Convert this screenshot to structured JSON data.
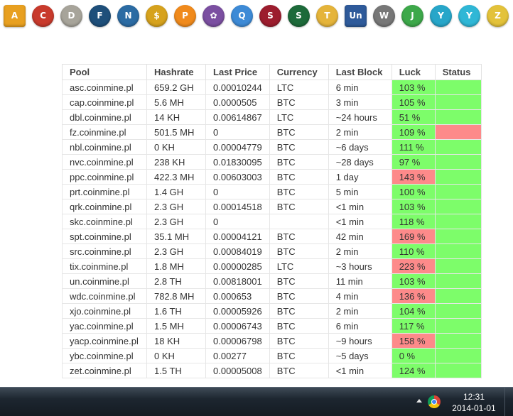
{
  "icons": [
    {
      "name": "asc-coin-icon",
      "color": "#e8a020",
      "glyph": "A",
      "shape": "square"
    },
    {
      "name": "cap-coin-icon",
      "color": "#c83a2c",
      "glyph": "C",
      "shape": "round"
    },
    {
      "name": "dbl-coin-icon",
      "color": "#a7a49a",
      "glyph": "D",
      "shape": "round"
    },
    {
      "name": "fz-coin-icon",
      "color": "#1e4f7a",
      "glyph": "F",
      "shape": "round"
    },
    {
      "name": "nbl-coin-icon",
      "color": "#2b6ba3",
      "glyph": "N",
      "shape": "round"
    },
    {
      "name": "nvc-coin-icon",
      "color": "#d6a21d",
      "glyph": "$",
      "shape": "round"
    },
    {
      "name": "ppc-coin-icon",
      "color": "#f08a1c",
      "glyph": "P",
      "shape": "round"
    },
    {
      "name": "prt-coin-icon",
      "color": "#7b4fa1",
      "glyph": "✿",
      "shape": "round"
    },
    {
      "name": "qrk-coin-icon",
      "color": "#3d8ad6",
      "glyph": "Q",
      "shape": "round"
    },
    {
      "name": "skc-coin-icon",
      "color": "#9c1d2e",
      "glyph": "S",
      "shape": "round"
    },
    {
      "name": "spt-coin-icon",
      "color": "#1d6a3a",
      "glyph": "S",
      "shape": "round"
    },
    {
      "name": "src-coin-icon",
      "color": "#e5b43a",
      "glyph": "T",
      "shape": "round"
    },
    {
      "name": "un-coin-icon",
      "color": "#2e5a9a",
      "glyph": "Un",
      "shape": "square"
    },
    {
      "name": "wdc-coin-icon",
      "color": "#777777",
      "glyph": "W",
      "shape": "round"
    },
    {
      "name": "xjo-coin-icon",
      "color": "#3da84a",
      "glyph": "J",
      "shape": "round"
    },
    {
      "name": "yac-coin-icon",
      "color": "#27a6c9",
      "glyph": "Y",
      "shape": "round"
    },
    {
      "name": "yacp-coin-icon",
      "color": "#2fb7d6",
      "glyph": "Y",
      "shape": "round"
    },
    {
      "name": "zet-coin-icon",
      "color": "#e3c23a",
      "glyph": "Z",
      "shape": "round"
    }
  ],
  "table": {
    "headers": {
      "pool": "Pool",
      "hashrate": "Hashrate",
      "last_price": "Last Price",
      "currency": "Currency",
      "last_block": "Last Block",
      "luck": "Luck",
      "status": "Status"
    },
    "rows": [
      {
        "pool": "asc.coinmine.pl",
        "hashrate": "659.2 GH",
        "last_price": "0.00010244",
        "currency": "LTC",
        "last_block": "6 min",
        "luck": "103 %",
        "luck_state": "good",
        "status_state": "good"
      },
      {
        "pool": "cap.coinmine.pl",
        "hashrate": "5.6 MH",
        "last_price": "0.0000505",
        "currency": "BTC",
        "last_block": "3 min",
        "luck": "105 %",
        "luck_state": "good",
        "status_state": "good"
      },
      {
        "pool": "dbl.coinmine.pl",
        "hashrate": "14 KH",
        "last_price": "0.00614867",
        "currency": "LTC",
        "last_block": "~24 hours",
        "luck": "51 %",
        "luck_state": "good",
        "status_state": "good"
      },
      {
        "pool": "fz.coinmine.pl",
        "hashrate": "501.5 MH",
        "last_price": "0",
        "currency": "BTC",
        "last_block": "2 min",
        "luck": "109 %",
        "luck_state": "good",
        "status_state": "bad"
      },
      {
        "pool": "nbl.coinmine.pl",
        "hashrate": "0 KH",
        "last_price": "0.00004779",
        "currency": "BTC",
        "last_block": "~6 days",
        "luck": "111 %",
        "luck_state": "good",
        "status_state": "good"
      },
      {
        "pool": "nvc.coinmine.pl",
        "hashrate": "238 KH",
        "last_price": "0.01830095",
        "currency": "BTC",
        "last_block": "~28 days",
        "luck": "97 %",
        "luck_state": "good",
        "status_state": "good"
      },
      {
        "pool": "ppc.coinmine.pl",
        "hashrate": "422.3 MH",
        "last_price": "0.00603003",
        "currency": "BTC",
        "last_block": "1 day",
        "luck": "143 %",
        "luck_state": "bad",
        "status_state": "good"
      },
      {
        "pool": "prt.coinmine.pl",
        "hashrate": "1.4 GH",
        "last_price": "0",
        "currency": "BTC",
        "last_block": "5 min",
        "luck": "100 %",
        "luck_state": "good",
        "status_state": "good"
      },
      {
        "pool": "qrk.coinmine.pl",
        "hashrate": "2.3 GH",
        "last_price": "0.00014518",
        "currency": "BTC",
        "last_block": "<1 min",
        "luck": "103 %",
        "luck_state": "good",
        "status_state": "good"
      },
      {
        "pool": "skc.coinmine.pl",
        "hashrate": "2.3 GH",
        "last_price": "0",
        "currency": "",
        "last_block": "<1 min",
        "luck": "118 %",
        "luck_state": "good",
        "status_state": "good"
      },
      {
        "pool": "spt.coinmine.pl",
        "hashrate": "35.1 MH",
        "last_price": "0.00004121",
        "currency": "BTC",
        "last_block": "42 min",
        "luck": "169 %",
        "luck_state": "bad",
        "status_state": "good"
      },
      {
        "pool": "src.coinmine.pl",
        "hashrate": "2.3 GH",
        "last_price": "0.00084019",
        "currency": "BTC",
        "last_block": "2 min",
        "luck": "110 %",
        "luck_state": "good",
        "status_state": "good"
      },
      {
        "pool": "tix.coinmine.pl",
        "hashrate": "1.8 MH",
        "last_price": "0.00000285",
        "currency": "LTC",
        "last_block": "~3 hours",
        "luck": "223 %",
        "luck_state": "bad",
        "status_state": "good"
      },
      {
        "pool": "un.coinmine.pl",
        "hashrate": "2.8 TH",
        "last_price": "0.00818001",
        "currency": "BTC",
        "last_block": "11 min",
        "luck": "103 %",
        "luck_state": "good",
        "status_state": "good"
      },
      {
        "pool": "wdc.coinmine.pl",
        "hashrate": "782.8 MH",
        "last_price": "0.000653",
        "currency": "BTC",
        "last_block": "4 min",
        "luck": "136 %",
        "luck_state": "bad",
        "status_state": "good"
      },
      {
        "pool": "xjo.coinmine.pl",
        "hashrate": "1.6 TH",
        "last_price": "0.00005926",
        "currency": "BTC",
        "last_block": "2 min",
        "luck": "104 %",
        "luck_state": "good",
        "status_state": "good"
      },
      {
        "pool": "yac.coinmine.pl",
        "hashrate": "1.5 MH",
        "last_price": "0.00006743",
        "currency": "BTC",
        "last_block": "6 min",
        "luck": "117 %",
        "luck_state": "good",
        "status_state": "good"
      },
      {
        "pool": "yacp.coinmine.pl",
        "hashrate": "18 KH",
        "last_price": "0.00006798",
        "currency": "BTC",
        "last_block": "~9 hours",
        "luck": "158 %",
        "luck_state": "bad",
        "status_state": "good"
      },
      {
        "pool": "ybc.coinmine.pl",
        "hashrate": "0 KH",
        "last_price": "0.00277",
        "currency": "BTC",
        "last_block": "~5 days",
        "luck": "0 %",
        "luck_state": "good",
        "status_state": "good"
      },
      {
        "pool": "zet.coinmine.pl",
        "hashrate": "1.5 TH",
        "last_price": "0.00005008",
        "currency": "BTC",
        "last_block": "<1 min",
        "luck": "124 %",
        "luck_state": "good",
        "status_state": "good"
      }
    ]
  },
  "taskbar": {
    "time": "12:31",
    "date": "2014-01-01",
    "tray_icons": [
      "show-hidden-icons-icon",
      "chrome-icon"
    ]
  }
}
